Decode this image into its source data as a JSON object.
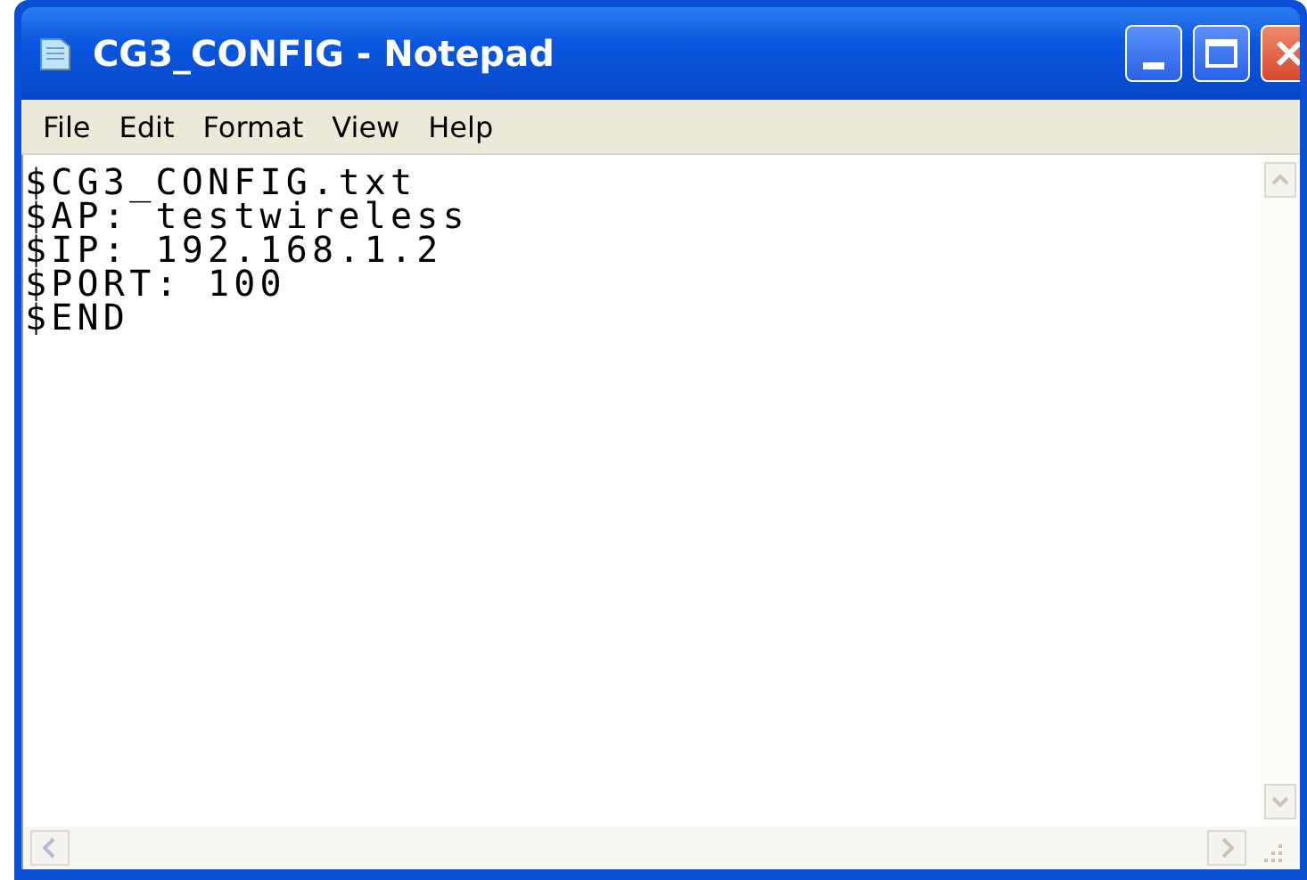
{
  "window": {
    "title": "CG3_CONFIG - Notepad"
  },
  "menu": [
    {
      "label": "File"
    },
    {
      "label": "Edit"
    },
    {
      "label": "Format"
    },
    {
      "label": "View"
    },
    {
      "label": "Help"
    }
  ],
  "editor": {
    "lines": [
      "$CG3_CONFIG.txt",
      "$AP: testwireless",
      "$IP: 192.168.1.2",
      "$PORT: 100",
      "$END"
    ]
  }
}
